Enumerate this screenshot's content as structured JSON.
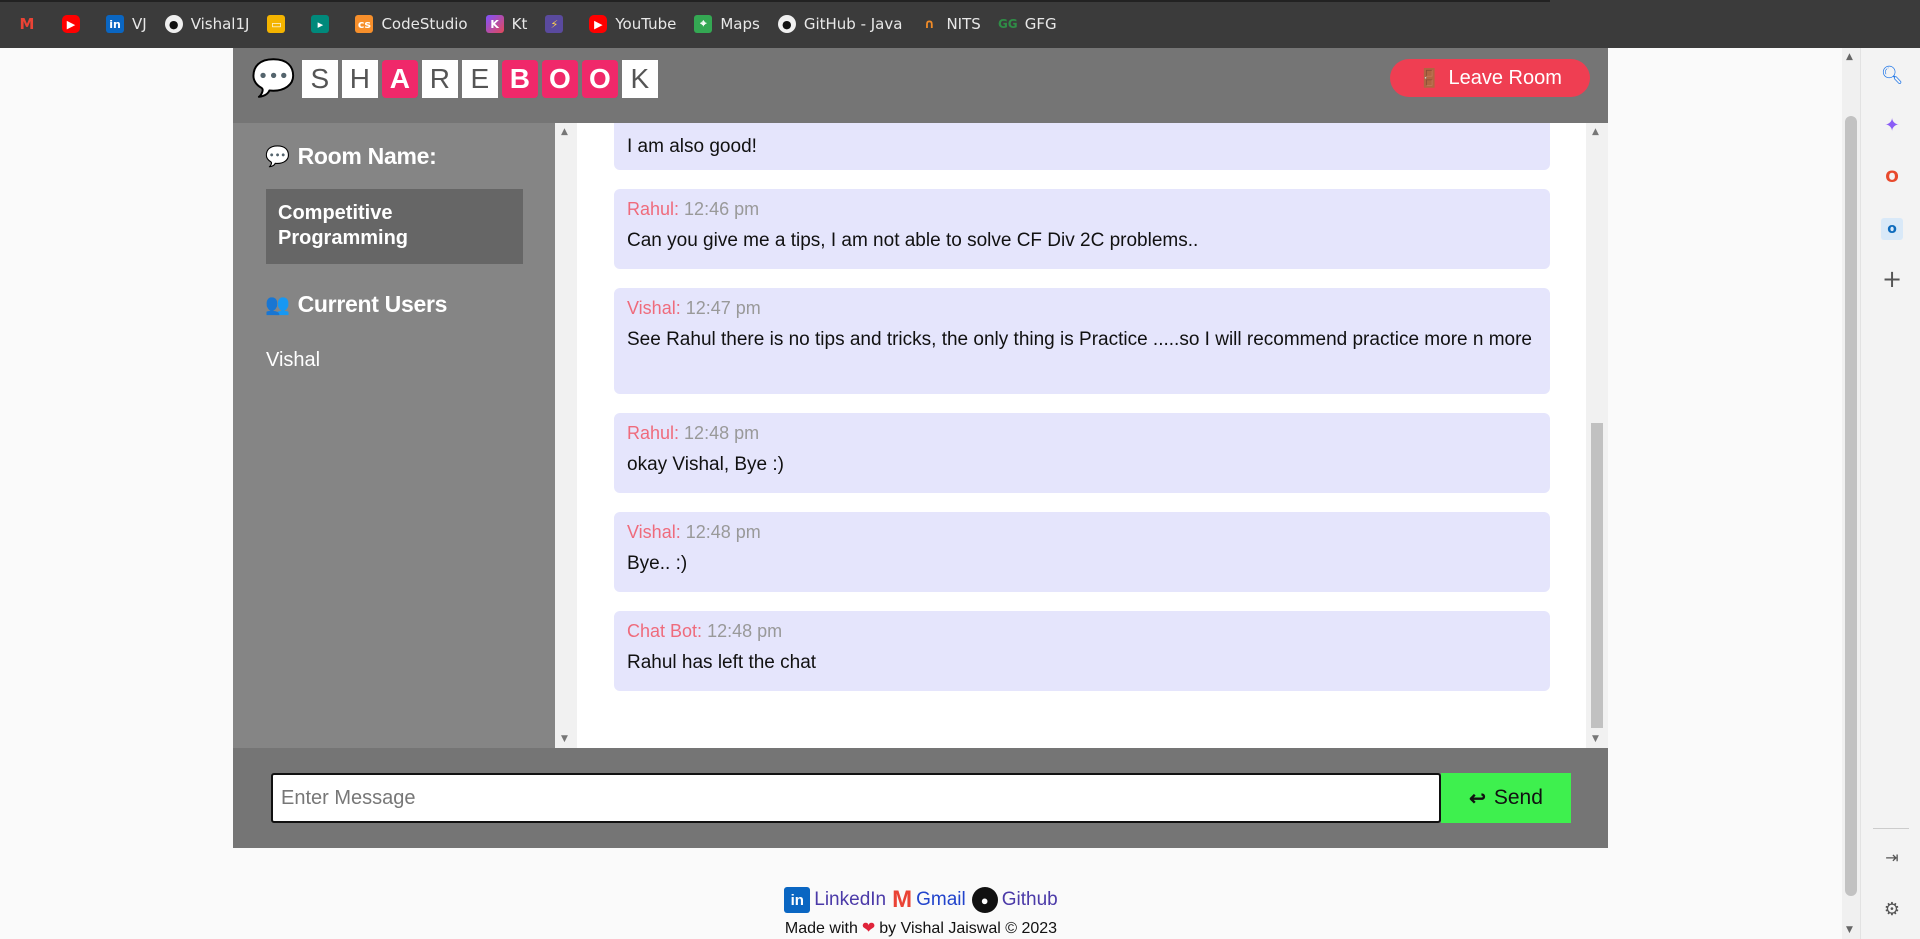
{
  "bookmarks": [
    {
      "label": "",
      "icon": "gmail-icon"
    },
    {
      "label": "",
      "icon": "youtube-icon"
    },
    {
      "label": "VJ",
      "icon": "linkedin-icon"
    },
    {
      "label": "Vishal1J",
      "icon": "github-icon"
    },
    {
      "label": "",
      "icon": "slides-icon"
    },
    {
      "label": "",
      "icon": "meet-icon"
    },
    {
      "label": "CodeStudio",
      "icon": "codestudio-icon"
    },
    {
      "label": "Kt",
      "icon": "kotlin-icon"
    },
    {
      "label": "",
      "icon": "bolt-icon"
    },
    {
      "label": "YouTube",
      "icon": "youtube-icon"
    },
    {
      "label": "Maps",
      "icon": "maps-icon"
    },
    {
      "label": "GitHub - Java",
      "icon": "github-icon"
    },
    {
      "label": "NITS",
      "icon": "nits-icon"
    },
    {
      "label": "GFG",
      "icon": "gfg-icon"
    }
  ],
  "header": {
    "logo_letters": [
      "S",
      "H",
      "A",
      "R",
      "E",
      "B",
      "O",
      "O",
      "K"
    ],
    "leave_label": "Leave Room"
  },
  "sidebar": {
    "room_heading": "Room Name:",
    "room_name": "Competitive Programming",
    "users_heading": "Current Users",
    "users": [
      "Vishal"
    ]
  },
  "messages": [
    {
      "author": "",
      "time": "",
      "text": "I am also good!"
    },
    {
      "author": "Rahul:",
      "time": "12:46 pm",
      "text": "Can you give me a tips, I am not able to solve CF Div 2C problems.."
    },
    {
      "author": "Vishal:",
      "time": "12:47 pm",
      "text": "See Rahul there is no tips and tricks, the only thing is Practice .....so I will recommend practice more n more"
    },
    {
      "author": "Rahul:",
      "time": "12:48 pm",
      "text": "okay Vishal, Bye :)"
    },
    {
      "author": "Vishal:",
      "time": "12:48 pm",
      "text": "Bye.. :)"
    },
    {
      "author": "Chat Bot:",
      "time": "12:48 pm",
      "text": "Rahul has left the chat"
    }
  ],
  "compose": {
    "placeholder": "Enter Message",
    "send_label": "Send"
  },
  "footer": {
    "linkedin": "LinkedIn",
    "gmail": "Gmail",
    "github": "Github",
    "made_prefix": "Made with",
    "made_suffix": "by Vishal Jaiswal © 2023"
  },
  "colors": {
    "accent_pink": "#f0286a",
    "leave_red": "#ef3e52",
    "send_green": "#3ef04e",
    "message_bg": "#e5e5fc",
    "author_color": "#ef6b7c"
  }
}
